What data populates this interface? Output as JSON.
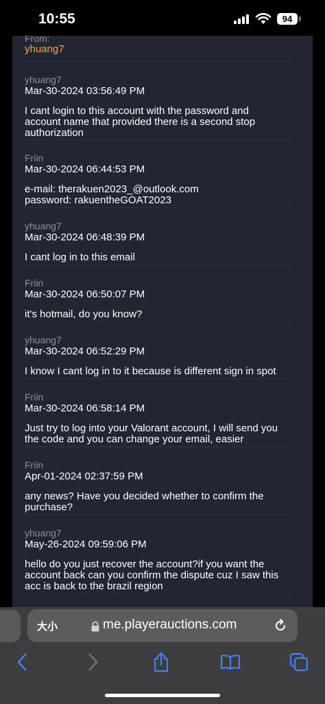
{
  "status_bar": {
    "time": "10:55",
    "battery": "94"
  },
  "header": {
    "from_label": "From:",
    "from_user": "yhuang7"
  },
  "messages": [
    {
      "sender": "yhuang7",
      "timestamp": "Mar-30-2024 03:56:49 PM",
      "text": "I cant login to this account with the password and\naccount name that provided there is a second stop\nauthorization"
    },
    {
      "sender": "Friin",
      "timestamp": "Mar-30-2024 06:44:53 PM",
      "text": "e-mail: therakuen2023_@outlook.com\npassword: rakuentheGOAT2023"
    },
    {
      "sender": "yhuang7",
      "timestamp": "Mar-30-2024 06:48:39 PM",
      "text": "I cant log in to this email"
    },
    {
      "sender": "Friin",
      "timestamp": "Mar-30-2024 06:50:07 PM",
      "text": "it's hotmail, do you know?"
    },
    {
      "sender": "yhuang7",
      "timestamp": "Mar-30-2024 06:52:29 PM",
      "text": "I know I cant log in to it because is different sign in spot"
    },
    {
      "sender": "Friin",
      "timestamp": "Mar-30-2024 06:58:14 PM",
      "text": "Just try to log into your Valorant account, I will send you\nthe code and you can change your email, easier"
    },
    {
      "sender": "Friin",
      "timestamp": "Apr-01-2024 02:37:59 PM",
      "text": "any news? Have you decided whether to confirm the\npurchase?"
    },
    {
      "sender": "yhuang7",
      "timestamp": "May-26-2024 09:59:06 PM",
      "text": "hello do you just recover the account?if you want the\naccount back can you confirm the dispute cuz I saw this\nacc is back to the brazil region"
    }
  ],
  "browser": {
    "aa_label": "大小",
    "url": "me.playerauctions.com"
  },
  "icons": {
    "lock": "lock-icon",
    "reload": "reload-icon",
    "back": "chevron-left-icon",
    "forward": "chevron-right-icon",
    "share": "share-icon",
    "bookmarks": "book-icon",
    "tabs": "tabs-icon"
  },
  "colors": {
    "panel": "#212632",
    "accent_user": "#f0a94b",
    "sender": "#8b909a",
    "link_blue": "#3b82f6"
  }
}
